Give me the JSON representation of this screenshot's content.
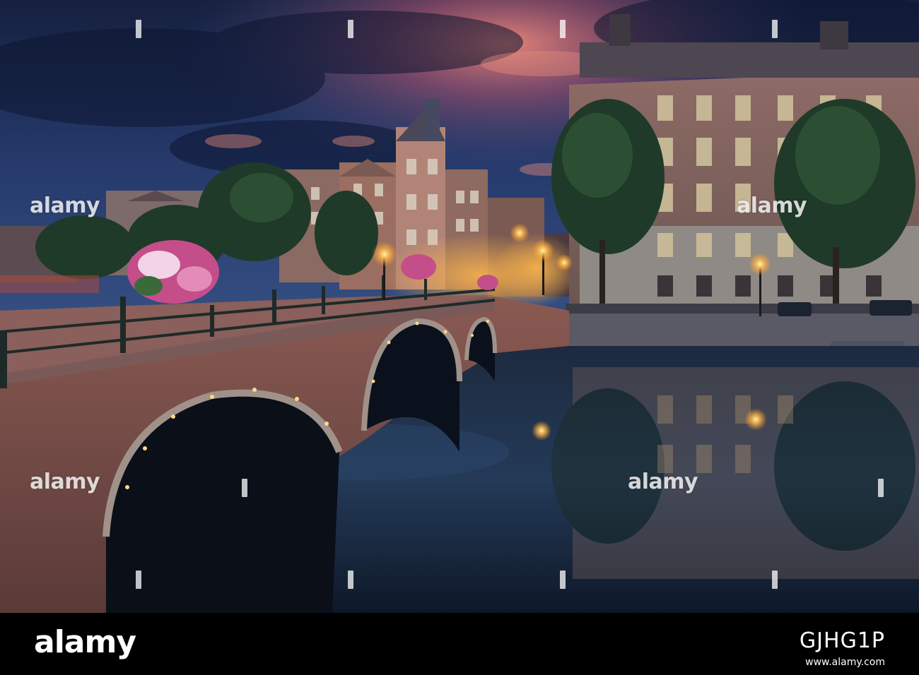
{
  "watermark": {
    "text": "alamy"
  },
  "footer": {
    "brand": "alamy",
    "image_id": "GJHG1P",
    "url": "www.alamy.com"
  }
}
